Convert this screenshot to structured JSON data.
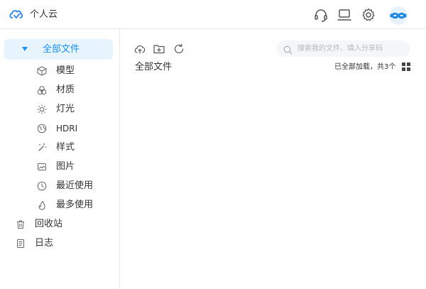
{
  "header": {
    "app_title": "个人云",
    "icons": [
      "cloud-logo-icon",
      "headset-icon",
      "laptop-icon",
      "gear-icon",
      "brand-mark-icon"
    ]
  },
  "sidebar": {
    "items": [
      {
        "label": "全部文件",
        "icon": "caret-down-icon",
        "active": true
      },
      {
        "label": "模型",
        "icon": "cube-icon"
      },
      {
        "label": "材质",
        "icon": "material-icon"
      },
      {
        "label": "灯光",
        "icon": "sun-icon"
      },
      {
        "label": "HDRI",
        "icon": "globe-icon"
      },
      {
        "label": "样式",
        "icon": "magic-wand-icon"
      },
      {
        "label": "图片",
        "icon": "image-icon"
      },
      {
        "label": "最近使用",
        "icon": "clock-icon"
      },
      {
        "label": "最多使用",
        "icon": "fire-icon"
      },
      {
        "label": "回收站",
        "icon": "trash-icon"
      },
      {
        "label": "日志",
        "icon": "log-icon"
      }
    ]
  },
  "main": {
    "toolbar": {
      "upload_icon": "upload-icon",
      "new_folder_icon": "new-folder-icon",
      "refresh_icon": "refresh-icon"
    },
    "search": {
      "placeholder": "搜索我的文件、填入分享码",
      "value": ""
    },
    "breadcrumb": "全部文件",
    "status": "已全部加载，共3个",
    "view_icon": "grid-view-icon"
  },
  "colors": {
    "accent": "#1890ff",
    "active_bg": "#e8f4fd",
    "text": "#333333",
    "icon": "#666666",
    "border": "#e8e8e8"
  }
}
